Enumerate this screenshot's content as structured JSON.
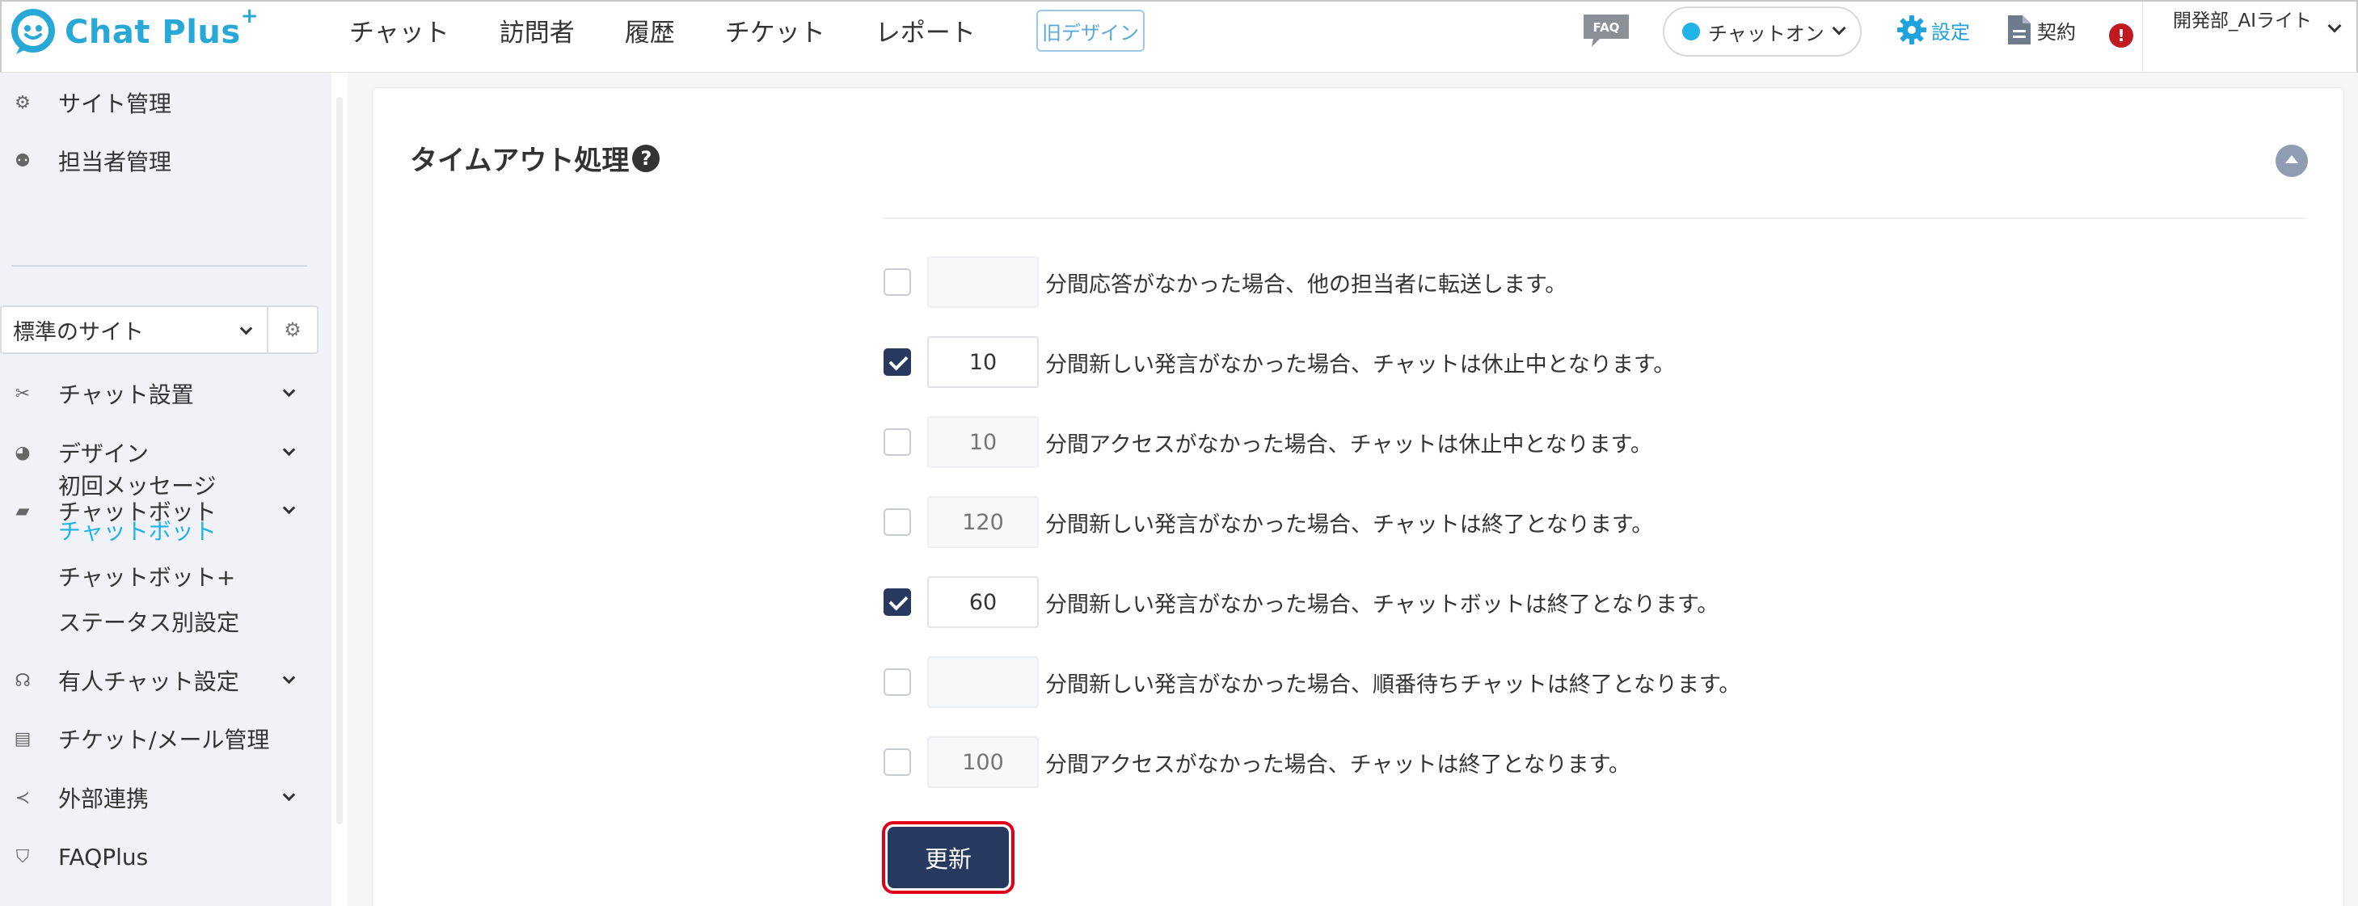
{
  "header": {
    "logo_text": "Chat Plus",
    "logo_sup": "+",
    "nav": [
      "チャット",
      "訪問者",
      "履歴",
      "チケット",
      "レポート"
    ],
    "old_design": "旧デザイン",
    "faq_badge": "FAQ",
    "chat_status": "チャットオン",
    "settings": "設定",
    "contract": "契約",
    "alert": "!",
    "user_name": "開発部_AIライト"
  },
  "sidebar": {
    "site_manage": "サイト管理",
    "staff_manage": "担当者管理",
    "site_select": "標準のサイト",
    "chat_setup": "チャット設置",
    "design": "デザイン",
    "chatbot": "チャットボット",
    "chatbot_sub": [
      "初回メッセージ",
      "チャットボット",
      "チャットボット+",
      "ステータス別設定"
    ],
    "manned_chat": "有人チャット設定",
    "ticket_mail": "チケット/メール管理",
    "external": "外部連携",
    "faqplus": "FAQPlus"
  },
  "panel": {
    "title": "タイムアウト処理",
    "help": "?",
    "rows": [
      {
        "checked": false,
        "value": "",
        "placeholder": "",
        "text": "分間応答がなかった場合、他の担当者に転送します。"
      },
      {
        "checked": true,
        "value": "10",
        "placeholder": "",
        "text": "分間新しい発言がなかった場合、チャットは休止中となります。"
      },
      {
        "checked": false,
        "value": "",
        "placeholder": "10",
        "text": "分間アクセスがなかった場合、チャットは休止中となります。"
      },
      {
        "checked": false,
        "value": "",
        "placeholder": "120",
        "text": "分間新しい発言がなかった場合、チャットは終了となります。"
      },
      {
        "checked": true,
        "value": "60",
        "placeholder": "",
        "text": "分間新しい発言がなかった場合、チャットボットは終了となります。"
      },
      {
        "checked": false,
        "value": "",
        "placeholder": "",
        "text": "分間新しい発言がなかった場合、順番待ちチャットは終了となります。"
      },
      {
        "checked": false,
        "value": "",
        "placeholder": "100",
        "text": "分間アクセスがなかった場合、チャットは終了となります。"
      }
    ],
    "update_label": "更新"
  },
  "colors": {
    "brand": "#27a8d6",
    "primary_button": "#27395f",
    "active_link": "#1fb3e8",
    "highlight_border": "#e0001a",
    "alert": "#c0191f"
  }
}
